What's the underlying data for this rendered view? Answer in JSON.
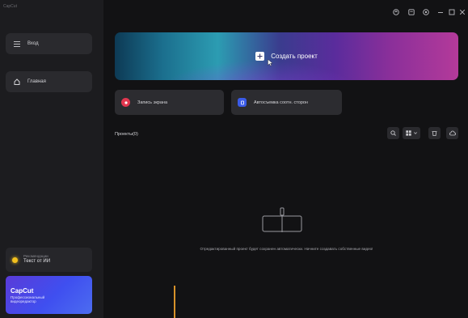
{
  "app_title": "CapCut",
  "sidebar": {
    "login_label": "Вход",
    "home_label": "Главная",
    "promo": {
      "small": "Рекомендации",
      "main": "Текст от ИИ"
    },
    "capcut": {
      "title": "CapCut",
      "line1": "Профессиональный",
      "line2": "видеоредактор"
    }
  },
  "hero": {
    "label": "Создать проект"
  },
  "actions": {
    "screen_record": "Запись экрана",
    "auto_reframe": "Автосъемка соотн. сторон"
  },
  "projects": {
    "title": "Проекты(0)"
  },
  "empty_state": {
    "message": "Отредактированный проект будет сохранен автоматически. Начните создавать собственные видео!"
  },
  "colors": {
    "accent_yellow": "#f2c01e",
    "record_red": "#e2374f",
    "reframe_blue": "#3a5be8",
    "orange_line": "#d8922a"
  }
}
